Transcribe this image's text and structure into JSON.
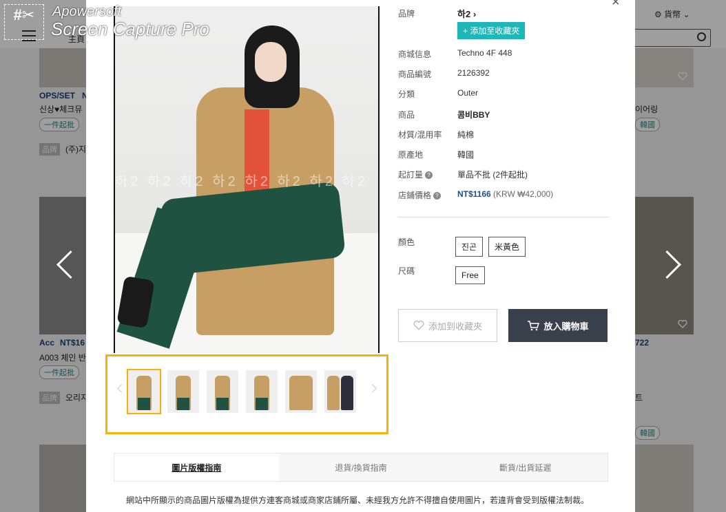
{
  "background": {
    "home_label": "主頁",
    "currency_label": "貨幣",
    "left_cards": [
      {
        "title": "OPS/SET",
        "title2": "N",
        "subtitle": "신상♥체크뮤",
        "tag": "一件起批",
        "brand_label": "品牌",
        "brand": "(주)지"
      },
      {
        "title": "Acc",
        "title2": "NT$16",
        "subtitle": "A003 체인 반",
        "tag": "一件起批",
        "brand_label": "品牌",
        "brand": "오리지"
      }
    ],
    "right_cards": [
      {
        "subtitle": "이어링",
        "tag": "韓國"
      },
      {
        "title": "722",
        "subtitle": "트",
        "tag": "韓國"
      }
    ]
  },
  "watermark_app": {
    "line1": "Apowersoft",
    "line2": "Screen Capture Pro"
  },
  "modal": {
    "close_icon": "×",
    "image_watermark": "하2 하2 하2 하2 하2 하2 하2 하2",
    "thumbnails": [
      {
        "name": "thumb-1",
        "selected": true
      },
      {
        "name": "thumb-2",
        "selected": false
      },
      {
        "name": "thumb-3",
        "selected": false
      },
      {
        "name": "thumb-4",
        "selected": false
      },
      {
        "name": "thumb-5",
        "selected": false
      },
      {
        "name": "thumb-6",
        "selected": false
      }
    ],
    "info": {
      "brand_label": "品牌",
      "brand_value": "하2",
      "add_fav_label": "+ 添加至收藏夾",
      "mall_label": "商城信息",
      "mall_value": "Techno 4F 448",
      "code_label": "商品編號",
      "code_value": "2126392",
      "category_label": "分類",
      "category_value": "Outer",
      "product_label": "商品",
      "product_value": "콤비BBY",
      "material_label": "材質/混用率",
      "material_value": "純棉",
      "origin_label": "原產地",
      "origin_value": "韓國",
      "moq_label": "起訂量",
      "moq_value": "單品不批 (2件起批)",
      "price_label": "店鋪價格",
      "price_value": "NT$1166",
      "price_krw": "(KRW ₩42,000)",
      "color_label": "顏色",
      "colors": [
        "진곤",
        "米黃色"
      ],
      "size_label": "尺碼",
      "sizes": [
        "Free"
      ],
      "fav_button": "添加到收藏夾",
      "cart_button": "放入購物車"
    },
    "tabs": [
      "圖片版權指南",
      "退貨/換貨指南",
      "斷貨/出貨延遲"
    ],
    "description": "網站中所顯示的商品圖片版權為提供方連客商城或商家店鋪所屬、未經我方允許不得擅自使用圖片，若違背會受到版權法制裁。"
  }
}
